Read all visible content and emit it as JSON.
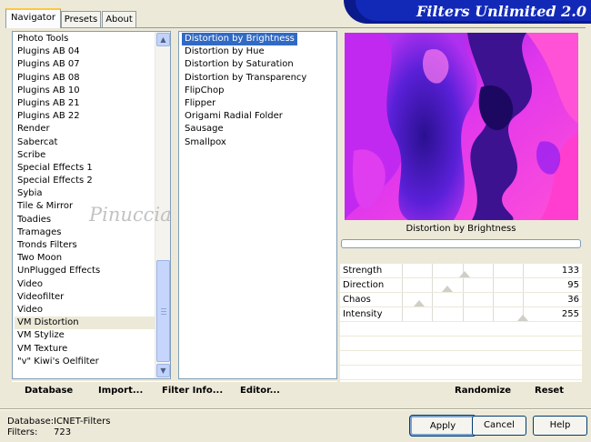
{
  "tabs": [
    {
      "label": "Navigator",
      "active": true
    },
    {
      "label": "Presets",
      "active": false
    },
    {
      "label": "About",
      "active": false
    }
  ],
  "banner": {
    "title": "Filters Unlimited 2.0"
  },
  "categories": [
    {
      "label": "Photo Tools"
    },
    {
      "label": "Plugins AB 04"
    },
    {
      "label": "Plugins AB 07"
    },
    {
      "label": "Plugins AB 08"
    },
    {
      "label": "Plugins AB 10"
    },
    {
      "label": "Plugins AB 21"
    },
    {
      "label": "Plugins AB 22"
    },
    {
      "label": "Render"
    },
    {
      "label": "Sabercat"
    },
    {
      "label": "Scribe"
    },
    {
      "label": "Special Effects 1"
    },
    {
      "label": "Special Effects 2"
    },
    {
      "label": "Sybia"
    },
    {
      "label": "Tile & Mirror"
    },
    {
      "label": "Toadies"
    },
    {
      "label": "Tramages"
    },
    {
      "label": "Tronds Filters"
    },
    {
      "label": "Two Moon"
    },
    {
      "label": "UnPlugged Effects"
    },
    {
      "label": "Video"
    },
    {
      "label": "Videofilter"
    },
    {
      "label": "Video"
    },
    {
      "label": "VM Distortion",
      "selected": true
    },
    {
      "label": "VM Stylize"
    },
    {
      "label": "VM Texture"
    },
    {
      "label": "\"v\" Kiwi's Oelfilter"
    }
  ],
  "filters": [
    {
      "label": "Distortion by Brightness",
      "selected": true
    },
    {
      "label": "Distortion by Hue"
    },
    {
      "label": "Distortion by Saturation"
    },
    {
      "label": "Distortion by Transparency"
    },
    {
      "label": "FlipChop"
    },
    {
      "label": "Flipper"
    },
    {
      "label": "Origami Radial Folder"
    },
    {
      "label": "Sausage"
    },
    {
      "label": "Smallpox"
    }
  ],
  "watermark": "Pinuccia",
  "preview": {
    "filter_name": "Distortion by Brightness",
    "progress": 0
  },
  "params": [
    {
      "label": "Strength",
      "value": "133",
      "level": 133
    },
    {
      "label": "Direction",
      "value": "95",
      "level": 95
    },
    {
      "label": "Chaos",
      "value": "36",
      "level": 36
    },
    {
      "label": "Intensity",
      "value": "255",
      "level": 255
    }
  ],
  "toolbar": {
    "database": "Database",
    "import": "Import...",
    "filter_info": "Filter Info...",
    "editor": "Editor...",
    "randomize": "Randomize",
    "reset": "Reset"
  },
  "status": {
    "database_label": "Database:",
    "database_value": "ICNET-Filters",
    "filters_label": "Filters:",
    "filters_value": "723"
  },
  "buttons": {
    "apply": "Apply",
    "cancel": "Cancel",
    "help": "Help"
  },
  "colors": {
    "selection": "#316ac5",
    "banner": "#1229b8"
  }
}
